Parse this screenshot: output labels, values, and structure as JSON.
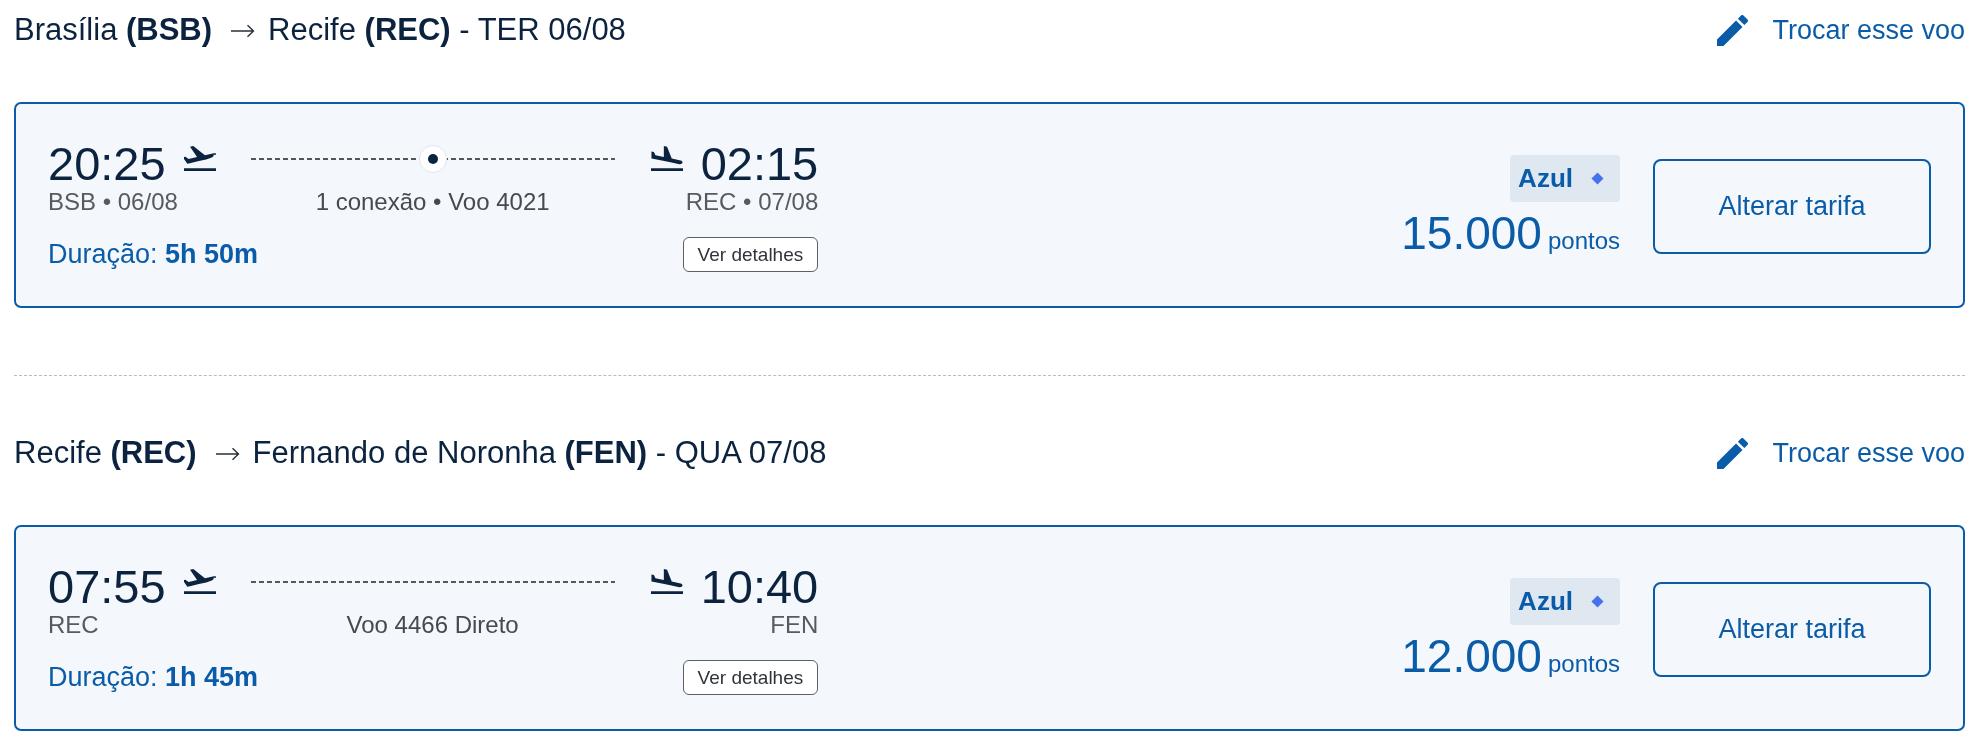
{
  "legs": [
    {
      "route": {
        "origin": "Brasília **(BSB)**",
        "destination": "Recife **(REC)** - TER 06/08"
      },
      "change_link": "Trocar esse voo",
      "flight": {
        "kind": "connection",
        "departure": {
          "time": "20:25",
          "detail": "BSB • 06/08"
        },
        "arrival": {
          "time": "02:15",
          "detail": "REC • 07/08"
        },
        "summary": "1 conexão • Voo 4021",
        "duration": "Duração: **5h 50m**",
        "details_button": "Ver detalhes"
      },
      "fare": {
        "brand": "Azul",
        "points": "15.000",
        "unit": "pontos",
        "button": "Alterar tarifa"
      }
    },
    {
      "route": {
        "origin": "Recife **(REC)**",
        "destination": "Fernando de Noronha **(FEN)** - QUA 07/08"
      },
      "change_link": "Trocar esse voo",
      "flight": {
        "kind": "direct",
        "departure": {
          "time": "07:55",
          "detail": "REC"
        },
        "arrival": {
          "time": "10:40",
          "detail": "FEN"
        },
        "summary": "Voo 4466 Direto",
        "duration": "Duração: **1h 45m**",
        "details_button": "Ver detalhes"
      },
      "fare": {
        "brand": "Azul",
        "points": "12.000",
        "unit": "pontos",
        "button": "Alterar tarifa"
      }
    }
  ]
}
